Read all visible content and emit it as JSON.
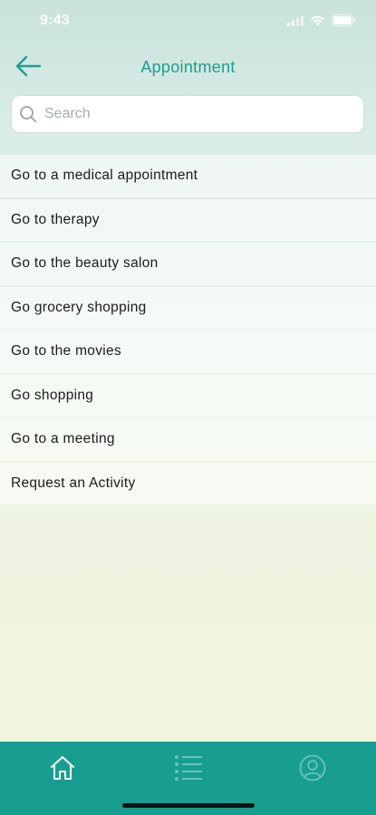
{
  "status_bar": {
    "time": "9:43"
  },
  "header": {
    "title": "Appointment",
    "back_icon": "arrow-left-icon",
    "accent_color": "#1f9e93"
  },
  "search": {
    "placeholder": "Search",
    "value": ""
  },
  "activities": [
    "Go to a medical appointment",
    "Go to therapy",
    "Go to the beauty salon",
    "Go grocery shopping",
    "Go to the movies",
    "Go shopping",
    "Go to a meeting",
    "Request an Activity"
  ],
  "tab_bar": {
    "background": "#179e91",
    "tabs": [
      {
        "icon": "home-icon",
        "active": true
      },
      {
        "icon": "list-icon",
        "active": false
      },
      {
        "icon": "profile-icon",
        "active": false
      }
    ]
  }
}
